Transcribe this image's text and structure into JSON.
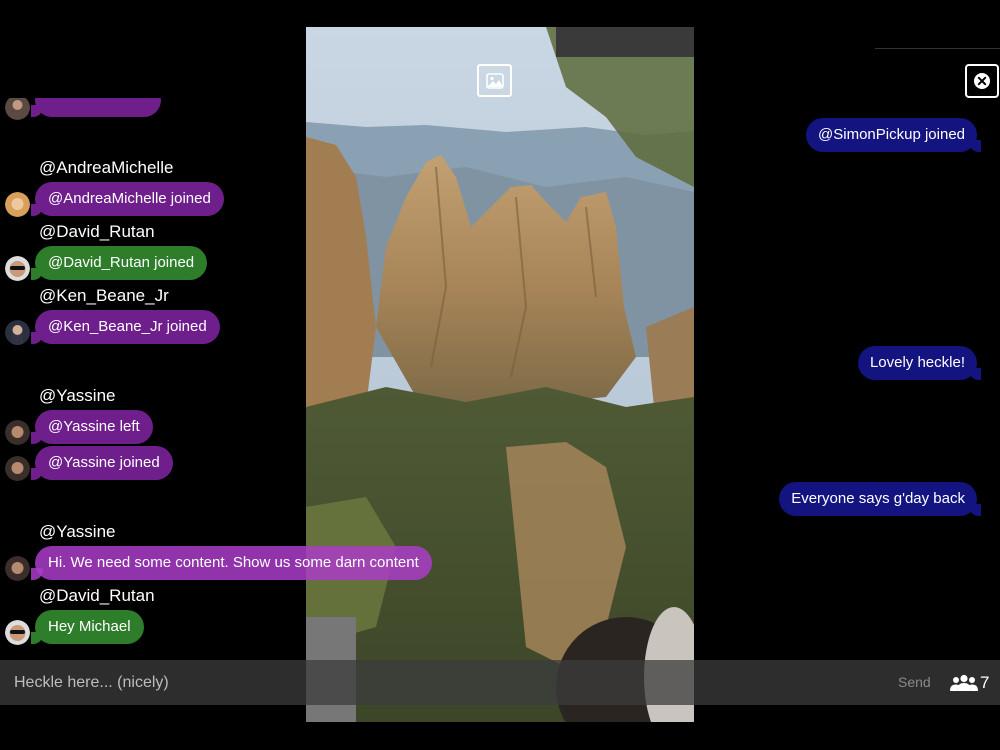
{
  "colors": {
    "purple_bubble": "#6e1f8c",
    "green_bubble": "#2e7d2a",
    "own_bubble": "#141480",
    "input_bar": "#3c3c3c"
  },
  "icons": {
    "image": "image-icon",
    "close": "close-circle-icon",
    "people": "people-icon"
  },
  "left_chat": {
    "g1": {
      "username": "@AndreaMichelle",
      "msg": "@AndreaMichelle joined"
    },
    "g2": {
      "username": "@David_Rutan",
      "msg": "@David_Rutan joined"
    },
    "g3": {
      "username": "@Ken_Beane_Jr",
      "msg": "@Ken_Beane_Jr joined"
    },
    "g4": {
      "username": "@Yassine",
      "msg1": "@Yassine left",
      "msg2": "@Yassine joined"
    },
    "g5": {
      "username": "@Yassine",
      "msg": "Hi. We need some content. Show us some darn content"
    },
    "g6": {
      "username": "@David_Rutan",
      "msg": "Hey Michael"
    }
  },
  "right_chat": {
    "m1": "@SimonPickup joined",
    "m2": "Lovely heckle!",
    "m3": "Everyone says g'day back"
  },
  "input": {
    "placeholder": "Heckle here... (nicely)",
    "value": ""
  },
  "send_label": "Send",
  "viewer_count": "7"
}
